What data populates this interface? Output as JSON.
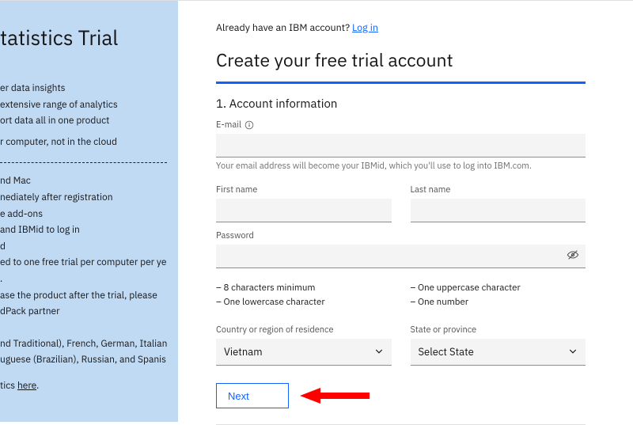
{
  "sidebar": {
    "title": "tatistics Trial",
    "bullets_a": [
      "er data insights",
      "extensive range of analytics",
      "ort data all in one product",
      "r computer, not in the cloud"
    ],
    "bullets_b": [
      "nd Mac",
      "nediately after registration",
      "e add-ons",
      "and IBMid to log in",
      "d",
      "ed to one free trial per computer per year",
      ".",
      "ase the product after the trial, please",
      "dPack partner"
    ],
    "footer_line1": "nd Traditional), French, German, Italian,",
    "footer_line2": "uguese (Brazilian), Russian, and Spanish.",
    "footer_more_prefix": "tics ",
    "footer_more_link": "here"
  },
  "header": {
    "already_text": "Already have an IBM account?",
    "login_text": "Log in",
    "title": "Create your free trial account"
  },
  "section": {
    "title": "1. Account information"
  },
  "fields": {
    "email_label": "E-mail",
    "email_helper": "Your email address will become your IBMid, which you'll use to log into IBM.com.",
    "first_name_label": "First name",
    "last_name_label": "Last name",
    "password_label": "Password",
    "country_label": "Country or region of residence",
    "state_label": "State or province"
  },
  "password_reqs": {
    "r1": "8 characters minimum",
    "r2": "One lowercase character",
    "r3": "One uppercase character",
    "r4": "One number"
  },
  "selects": {
    "country_value": "Vietnam",
    "state_value": "Select State"
  },
  "buttons": {
    "next": "Next"
  }
}
